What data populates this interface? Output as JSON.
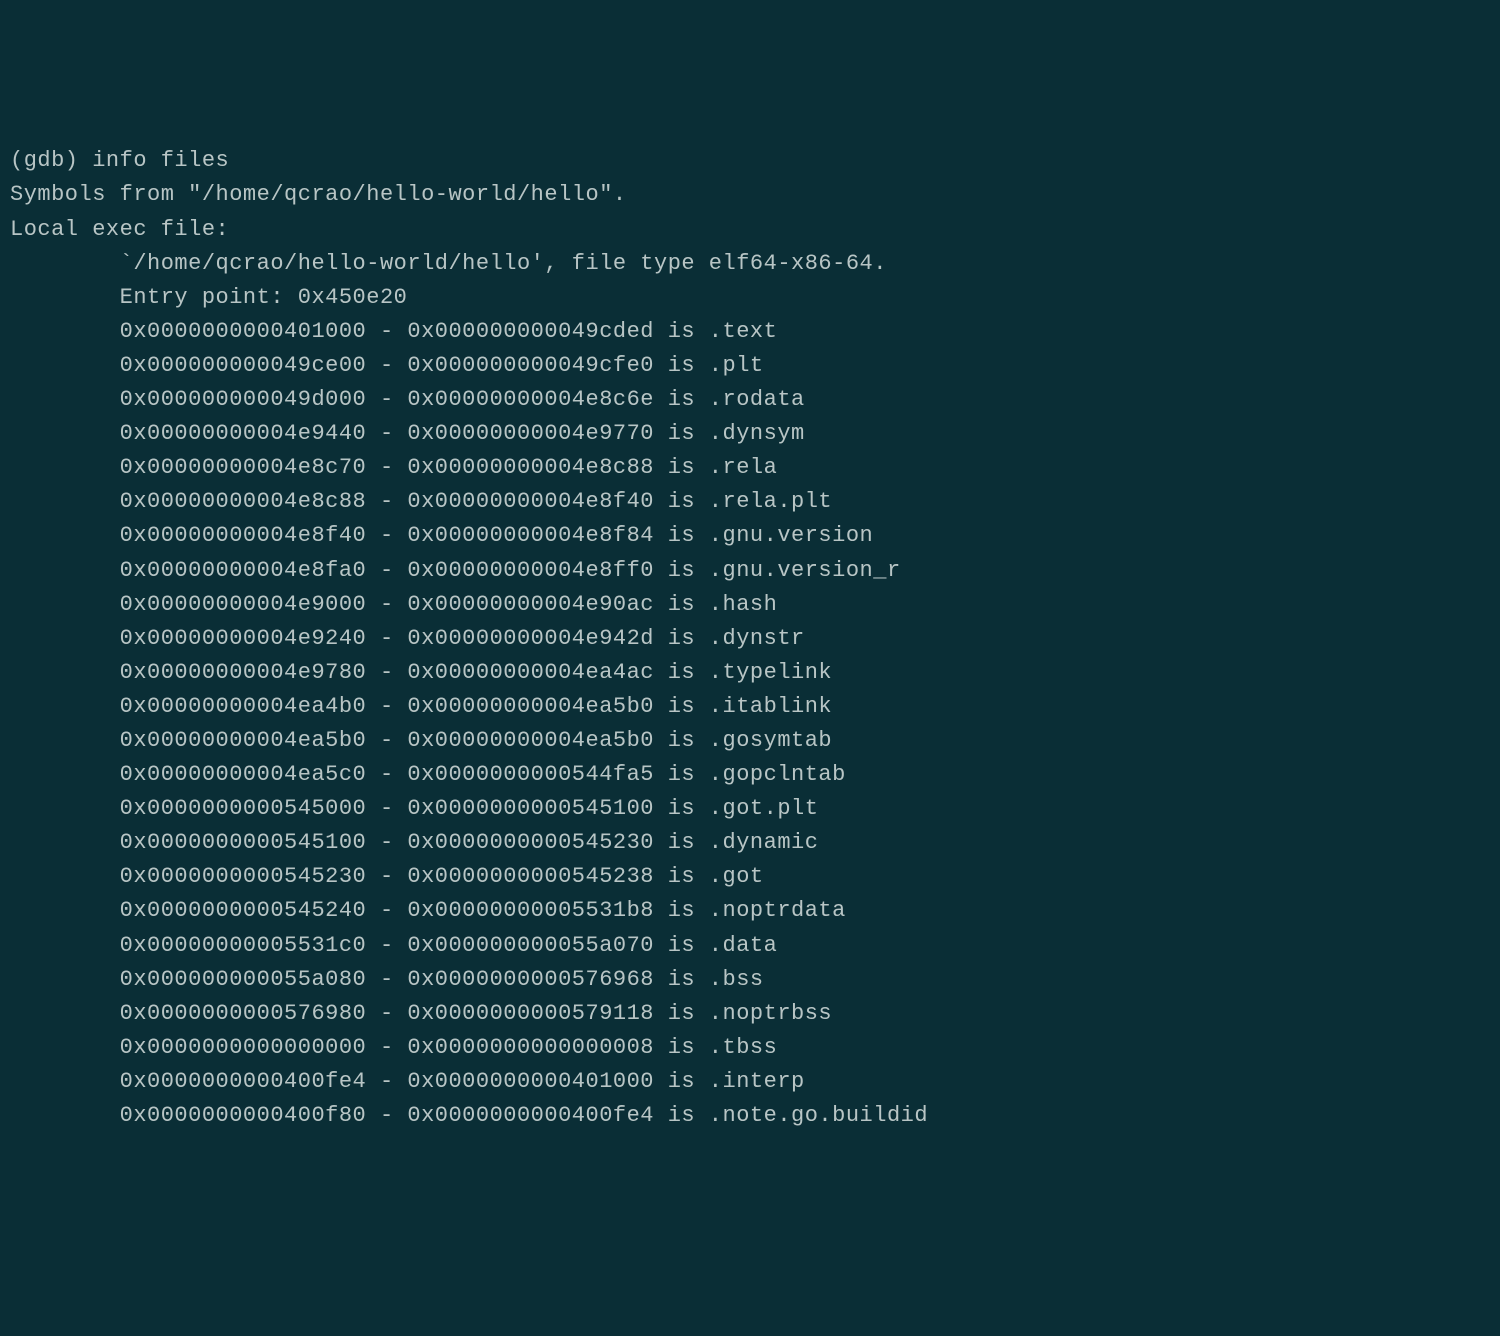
{
  "prompt": "(gdb) ",
  "command": "info files",
  "symbols_line": "Symbols from \"/home/qcrao/hello-world/hello\".",
  "local_exec_line": "Local exec file:",
  "file_info_line": "        `/home/qcrao/hello-world/hello', file type elf64-x86-64.",
  "entry_point_line": "        Entry point: 0x450e20",
  "sections": [
    {
      "text": "        0x0000000000401000 - 0x000000000049cded is .text"
    },
    {
      "text": "        0x000000000049ce00 - 0x000000000049cfe0 is .plt"
    },
    {
      "text": "        0x000000000049d000 - 0x00000000004e8c6e is .rodata"
    },
    {
      "text": "        0x00000000004e9440 - 0x00000000004e9770 is .dynsym"
    },
    {
      "text": "        0x00000000004e8c70 - 0x00000000004e8c88 is .rela"
    },
    {
      "text": "        0x00000000004e8c88 - 0x00000000004e8f40 is .rela.plt"
    },
    {
      "text": "        0x00000000004e8f40 - 0x00000000004e8f84 is .gnu.version"
    },
    {
      "text": "        0x00000000004e8fa0 - 0x00000000004e8ff0 is .gnu.version_r"
    },
    {
      "text": "        0x00000000004e9000 - 0x00000000004e90ac is .hash"
    },
    {
      "text": "        0x00000000004e9240 - 0x00000000004e942d is .dynstr"
    },
    {
      "text": "        0x00000000004e9780 - 0x00000000004ea4ac is .typelink"
    },
    {
      "text": "        0x00000000004ea4b0 - 0x00000000004ea5b0 is .itablink"
    },
    {
      "text": "        0x00000000004ea5b0 - 0x00000000004ea5b0 is .gosymtab"
    },
    {
      "text": "        0x00000000004ea5c0 - 0x0000000000544fa5 is .gopclntab"
    },
    {
      "text": "        0x0000000000545000 - 0x0000000000545100 is .got.plt"
    },
    {
      "text": "        0x0000000000545100 - 0x0000000000545230 is .dynamic"
    },
    {
      "text": "        0x0000000000545230 - 0x0000000000545238 is .got"
    },
    {
      "text": "        0x0000000000545240 - 0x00000000005531b8 is .noptrdata"
    },
    {
      "text": "        0x00000000005531c0 - 0x000000000055a070 is .data"
    },
    {
      "text": "        0x000000000055a080 - 0x0000000000576968 is .bss"
    },
    {
      "text": "        0x0000000000576980 - 0x0000000000579118 is .noptrbss"
    },
    {
      "text": "        0x0000000000000000 - 0x0000000000000008 is .tbss"
    },
    {
      "text": "        0x0000000000400fe4 - 0x0000000000401000 is .interp"
    },
    {
      "text": "        0x0000000000400f80 - 0x0000000000400fe4 is .note.go.buildid"
    }
  ]
}
